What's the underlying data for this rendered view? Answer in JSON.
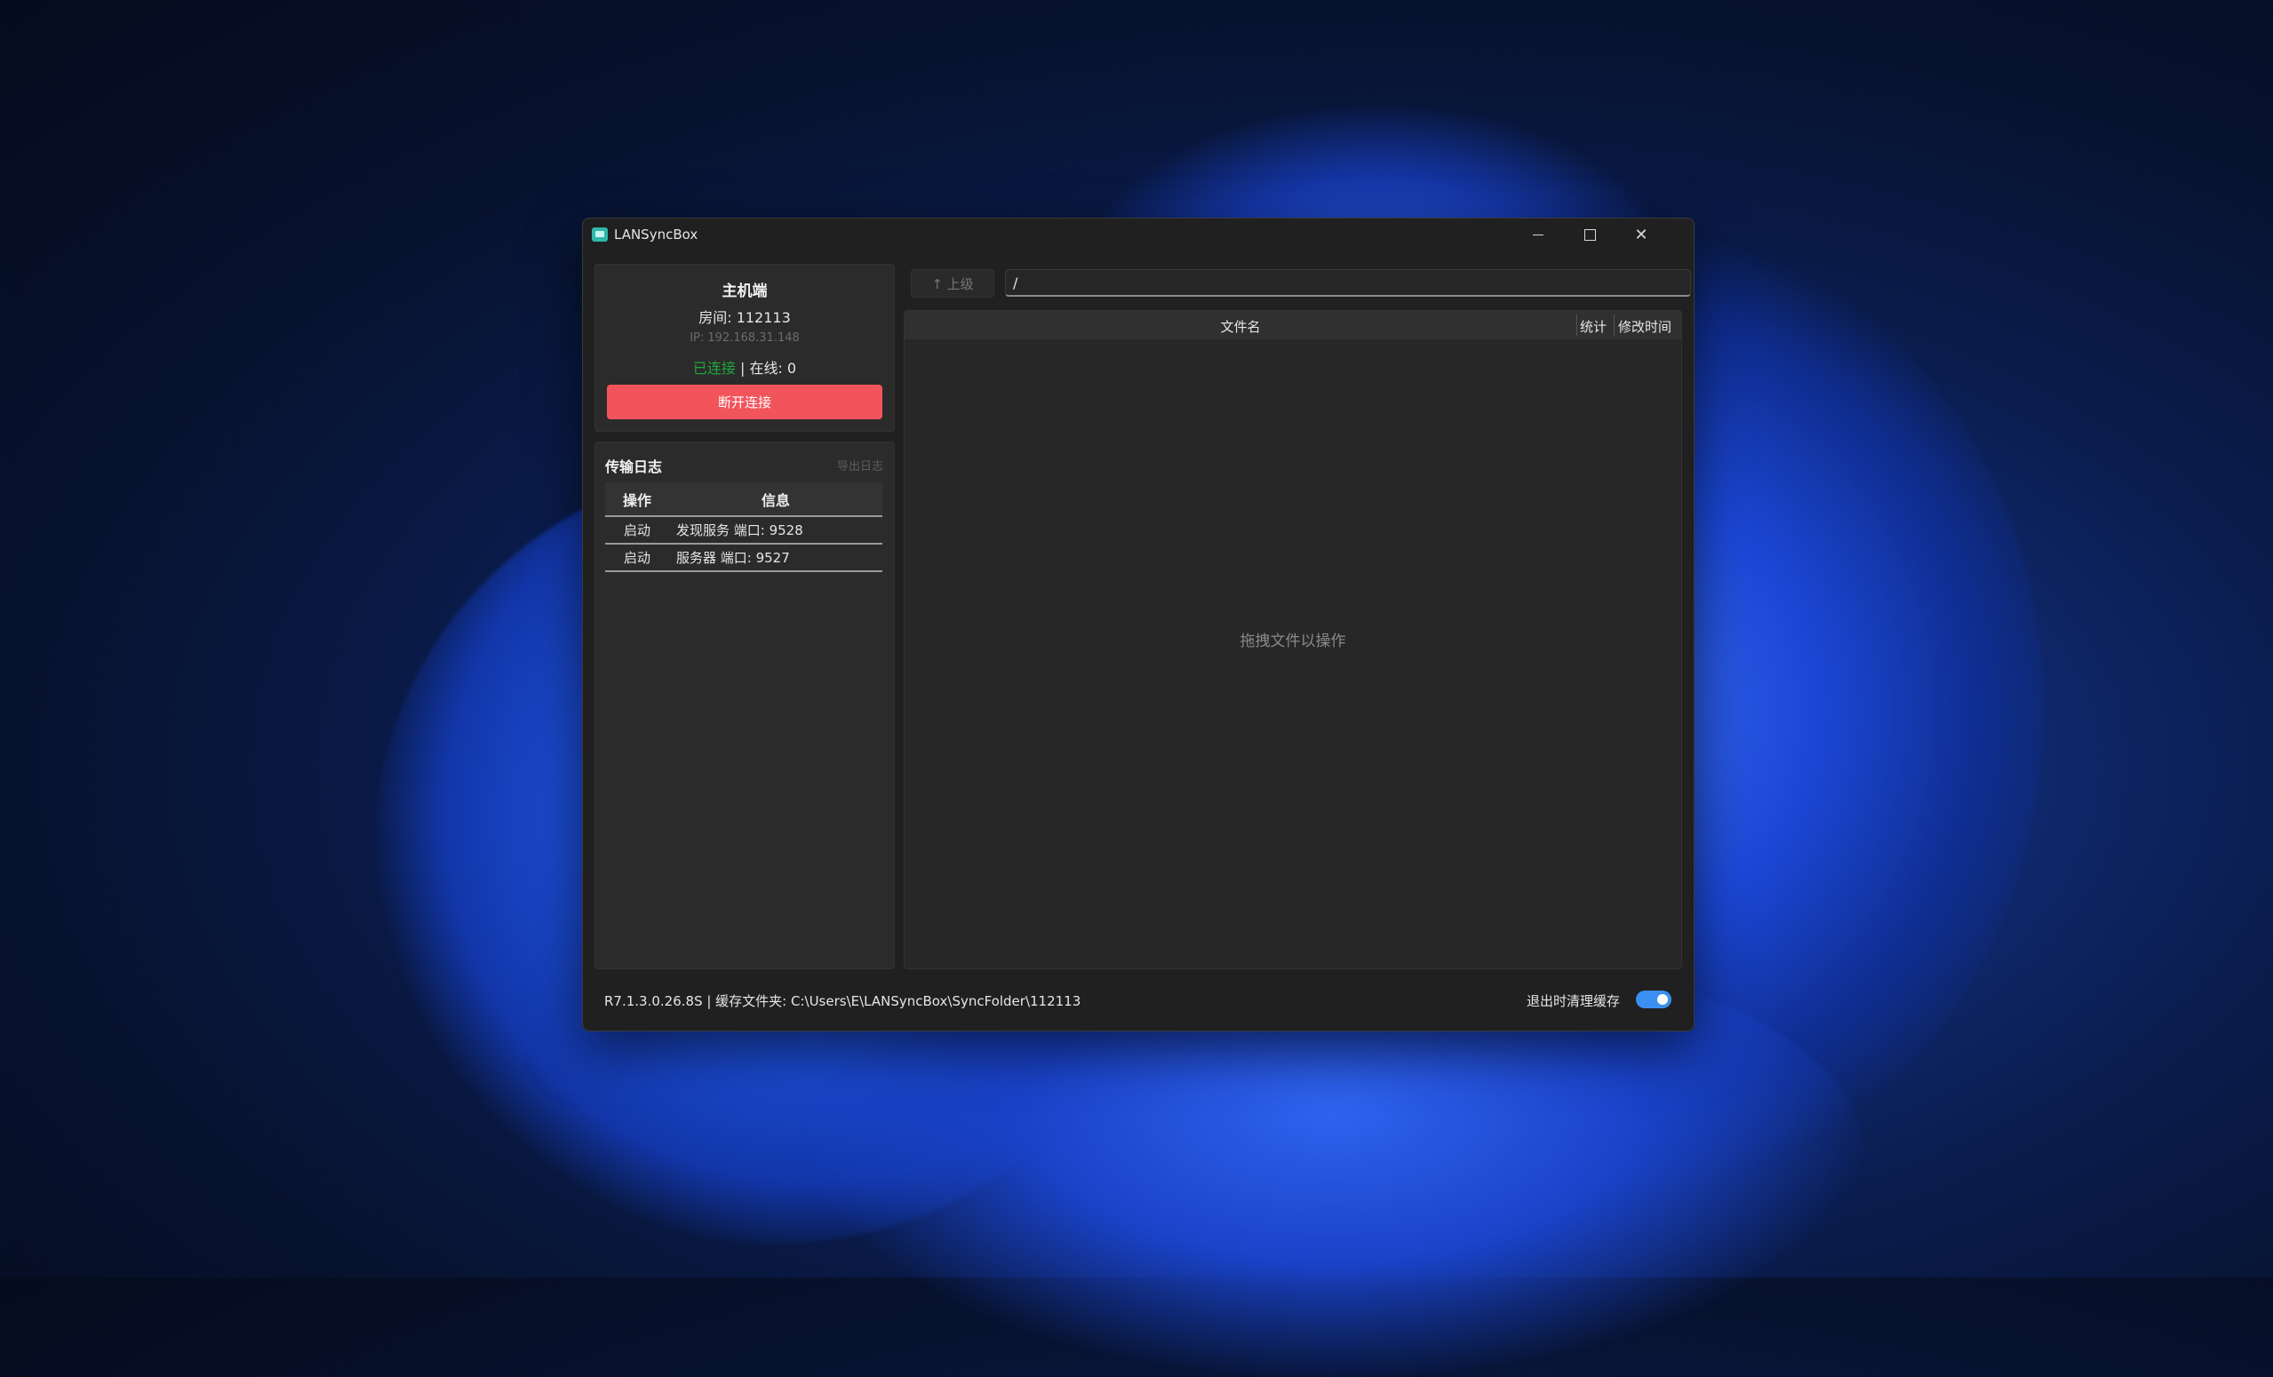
{
  "window": {
    "title": "LANSyncBox",
    "controls": {
      "minimize": "minimize",
      "maximize": "maximize",
      "close": "✕"
    }
  },
  "host": {
    "title": "主机端",
    "room": "房间: 112113",
    "ip": "IP: 192.168.31.148",
    "status_connected": "已连接",
    "status_rest": " | 在线: 0",
    "disconnect_label": "断开连接"
  },
  "log": {
    "title": "传输日志",
    "export_label": "导出日志",
    "columns": [
      "操作",
      "信息"
    ],
    "rows": [
      {
        "action": "启动",
        "info": "发现服务 端口: 9528"
      },
      {
        "action": "启动",
        "info": "服务器 端口: 9527"
      }
    ]
  },
  "browser": {
    "up_label": "↑ 上级",
    "path_value": "/",
    "columns": {
      "name": "文件名",
      "stats": "统计",
      "modified": "修改时间"
    },
    "empty_hint": "拖拽文件以操作"
  },
  "footer": {
    "info": "R7.1.3.0.26.8S  |  缓存文件夹: C:\\Users\\E\\LANSyncBox\\SyncFolder\\112113",
    "clear_cache_label": "退出时清理缓存",
    "clear_cache_on": true
  },
  "colors": {
    "accent": "#3a8ff0",
    "danger": "#f2545c",
    "connected": "#1fa83a"
  }
}
